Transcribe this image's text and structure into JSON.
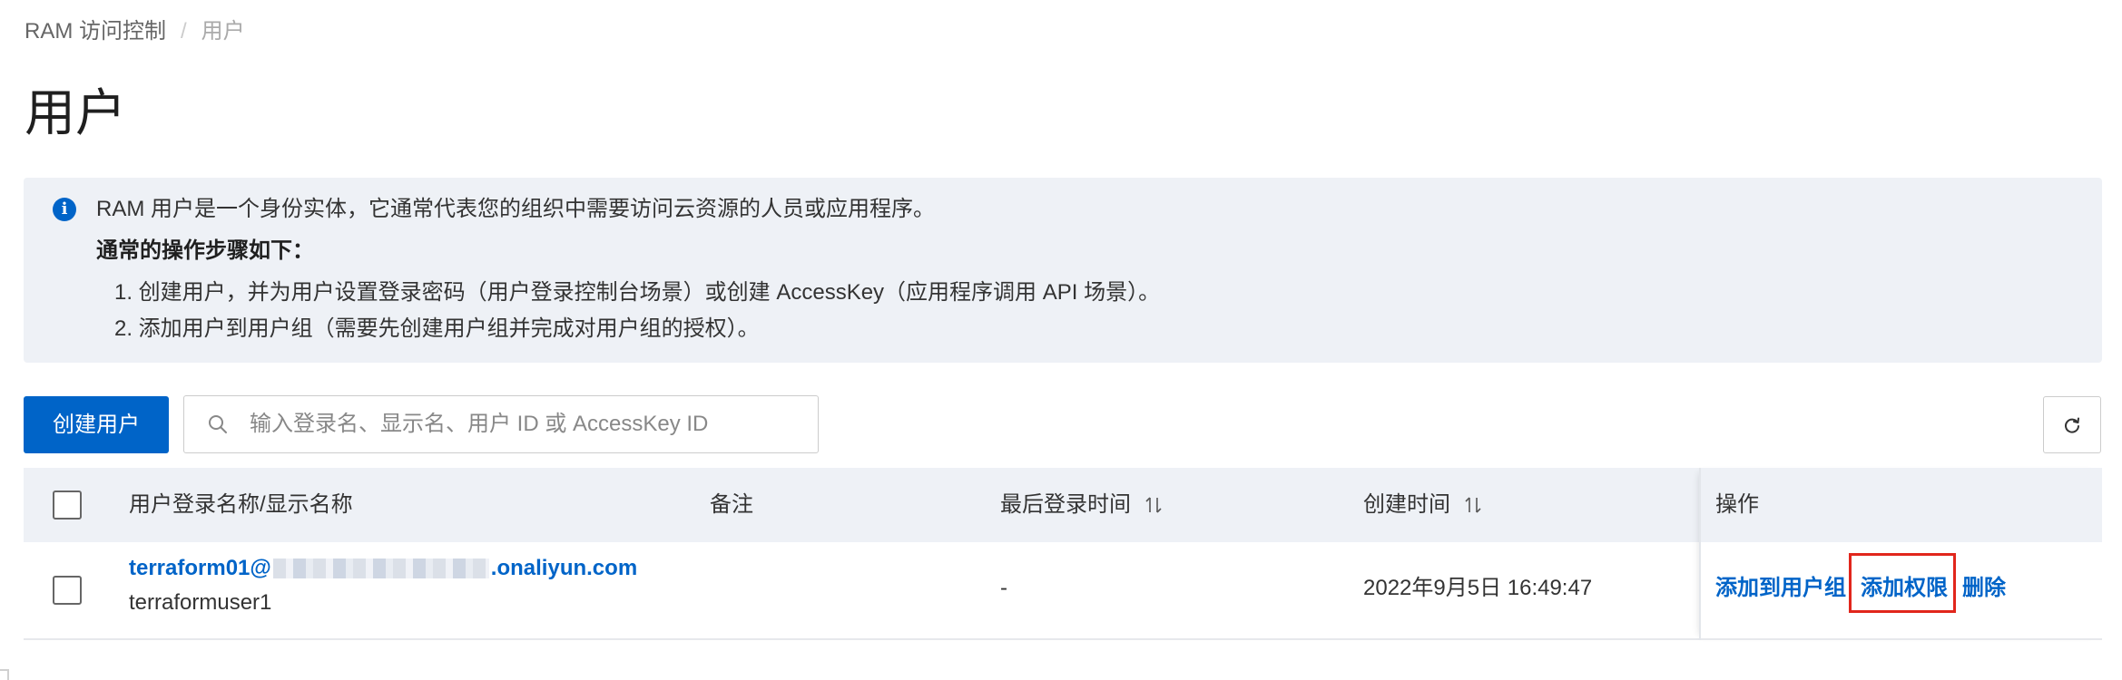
{
  "breadcrumb": {
    "root": "RAM 访问控制",
    "separator": "/",
    "current": "用户"
  },
  "page_title": "用户",
  "info": {
    "icon": "info-icon",
    "intro": "RAM 用户是一个身份实体，它通常代表您的组织中需要访问云资源的人员或应用程序。",
    "steps_title": "通常的操作步骤如下：",
    "step1": "1. 创建用户，并为用户设置登录密码（用户登录控制台场景）或创建 AccessKey（应用程序调用 API 场景）。",
    "step2": "2. 添加用户到用户组（需要先创建用户组并完成对用户组的授权）。"
  },
  "toolbar": {
    "create_label": "创建用户",
    "search_placeholder": "输入登录名、显示名、用户 ID 或 AccessKey ID",
    "search_value": "",
    "refresh_icon": "refresh-icon"
  },
  "table": {
    "columns": {
      "name": "用户登录名称/显示名称",
      "note": "备注",
      "last_login": "最后登录时间",
      "created": "创建时间",
      "actions": "操作"
    },
    "rows": [
      {
        "login_prefix": "terraform01@",
        "login_suffix": ".onaliyun.com",
        "display_name": "terraformuser1",
        "note": "",
        "last_login": "-",
        "created": "2022年9月5日 16:49:47",
        "actions": [
          "添加到用户组",
          "添加权限",
          "删除"
        ]
      }
    ]
  },
  "colors": {
    "primary": "#0064c8",
    "info_bg": "#eef1f6",
    "highlight": "#e1261c"
  }
}
